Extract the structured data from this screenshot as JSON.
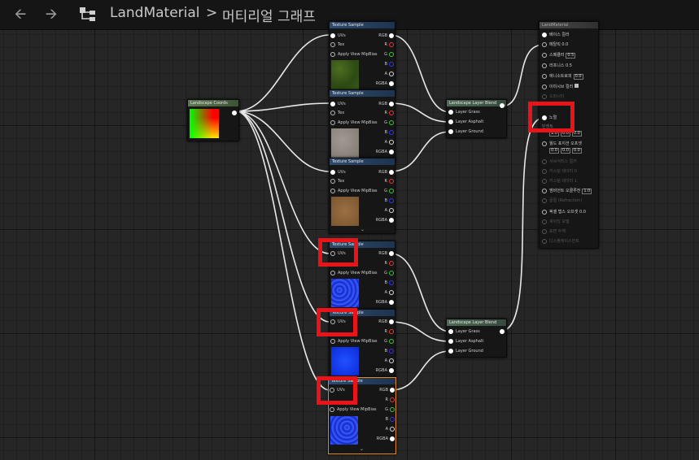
{
  "toolbar": {
    "back_icon": "arrow-left-icon",
    "forward_icon": "arrow-right-icon",
    "graph_icon": "graph-hierarchy-icon"
  },
  "breadcrumb": {
    "asset": "LandMaterial",
    "separator": ">",
    "graph": "머티리얼 그래프"
  },
  "nodes": {
    "coords": {
      "title": "Landscape Coords"
    },
    "tex": {
      "title": "Texture Sample",
      "uvs": "UVs",
      "tex": "Tex",
      "apply": "Apply View MipBias",
      "out_rgb": "RGB",
      "out_r": "R",
      "out_g": "G",
      "out_b": "B",
      "out_a": "A",
      "out_rgba": "RGBA"
    },
    "blend": {
      "title": "Landscape Layer Blend",
      "grass": "Layer Grass",
      "asphalt": "Layer Asphalt",
      "ground": "Layer Ground"
    },
    "result": {
      "title": "LandMaterial",
      "base_color": "베이스 컬러",
      "metallic": "메탈릭",
      "metallic_val": "0.0",
      "specular": "스페큘러",
      "specular_val": "0.5",
      "roughness": "러프니스",
      "roughness_val": "0.5",
      "anisotropy": "애니소트로피",
      "anisotropy_val": "0.0",
      "emissive": "이미시브 컬러",
      "opacity": "오파시티",
      "normal": "노멀",
      "tangent": "탄젠트",
      "tangent_x": "1.0",
      "tangent_y": "0.0",
      "tangent_z": "0.0",
      "wpo": "월드 포지션 오프셋",
      "wpo_x": "0.0",
      "wpo_y": "0.0",
      "wpo_z": "0.0",
      "subsurface": "서브서피스 컬러",
      "custom0": "커스텀 데이터 0",
      "custom1": "커스텀 데이터 1",
      "ao": "앰비언트 오클루전",
      "ao_val": "1.0",
      "refraction": "굴절 (Refraction)",
      "pdo": "픽셀 뎁스 오프셋",
      "pdo_val": "0.0",
      "shading": "셰이딩 모델",
      "surface": "표면 두께",
      "displacement": "디스플레이스먼트"
    }
  }
}
